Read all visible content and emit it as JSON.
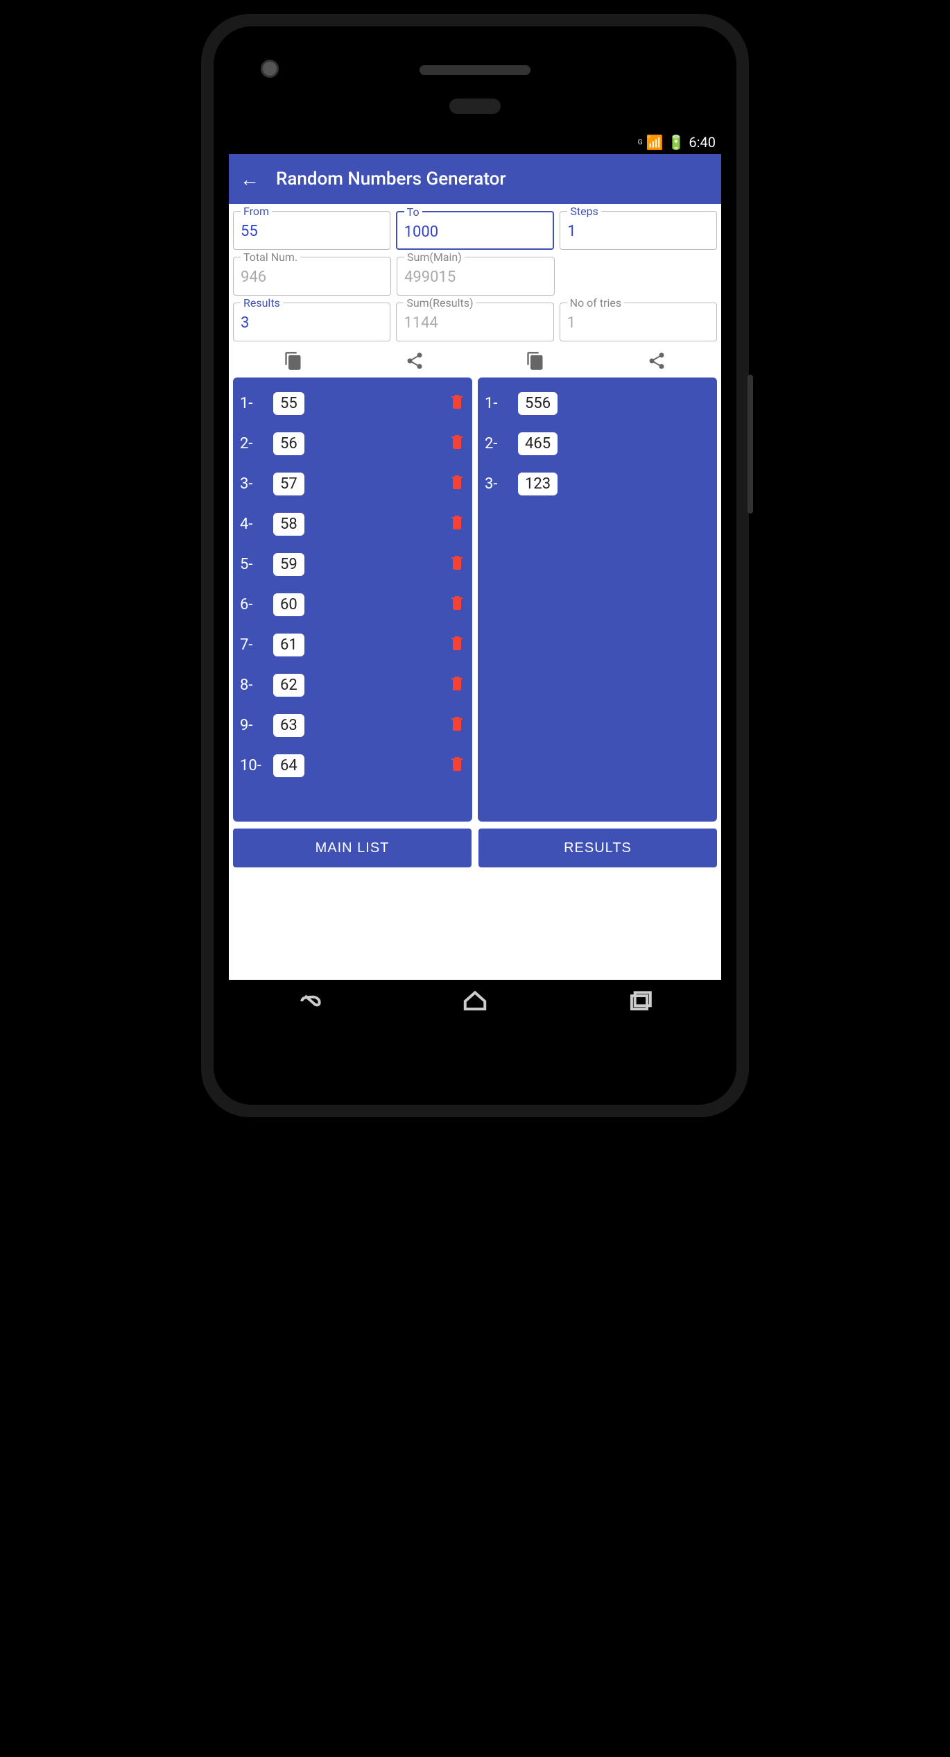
{
  "statusbar": {
    "time": "6:40",
    "network": "G"
  },
  "app": {
    "title": "Random Numbers Generator"
  },
  "fields": {
    "from": {
      "label": "From",
      "value": "55"
    },
    "to": {
      "label": "To",
      "value": "1000"
    },
    "steps": {
      "label": "Steps",
      "value": "1"
    },
    "totalNum": {
      "label": "Total Num.",
      "value": "946"
    },
    "sumMain": {
      "label": "Sum(Main)",
      "value": "499015"
    },
    "results": {
      "label": "Results",
      "value": "3"
    },
    "sumResults": {
      "label": "Sum(Results)",
      "value": "1144"
    },
    "noOfTries": {
      "label": "No of tries",
      "value": "1"
    }
  },
  "mainList": [
    {
      "idx": "1-",
      "val": "55"
    },
    {
      "idx": "2-",
      "val": "56"
    },
    {
      "idx": "3-",
      "val": "57"
    },
    {
      "idx": "4-",
      "val": "58"
    },
    {
      "idx": "5-",
      "val": "59"
    },
    {
      "idx": "6-",
      "val": "60"
    },
    {
      "idx": "7-",
      "val": "61"
    },
    {
      "idx": "8-",
      "val": "62"
    },
    {
      "idx": "9-",
      "val": "63"
    },
    {
      "idx": "10-",
      "val": "64"
    }
  ],
  "resultsList": [
    {
      "idx": "1-",
      "val": "556"
    },
    {
      "idx": "2-",
      "val": "465"
    },
    {
      "idx": "3-",
      "val": "123"
    }
  ],
  "buttons": {
    "mainList": "MAIN LIST",
    "results": "RESULTS"
  }
}
